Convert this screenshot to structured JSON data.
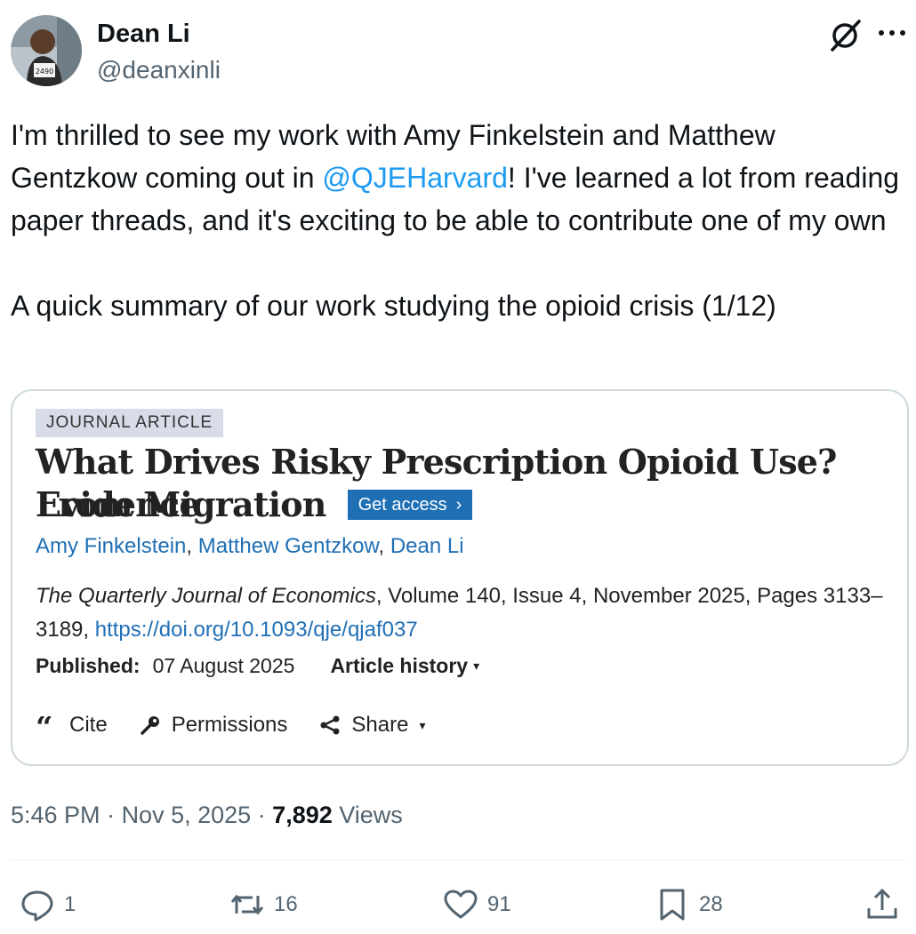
{
  "author": {
    "name": "Dean Li",
    "handle": "@deanxinli",
    "avatar_number": "2490"
  },
  "tweet": {
    "text_before_mention": "I'm thrilled to see my work with Amy Finkelstein and Matthew Gentzkow coming out in ",
    "mention": "@QJEHarvard",
    "text_after_mention": "! I've learned a lot from reading paper threads, and it's exciting to be able to contribute one of my own\n\nA quick summary of our work studying the opioid crisis (1/12)"
  },
  "card": {
    "badge": "JOURNAL ARTICLE",
    "title_line1": "What Drives Risky Prescription Opioid Use? Evidence",
    "title_line2": "From Migration",
    "access_label": "Get access",
    "access_chevron": "›",
    "authors": [
      "Amy Finkelstein",
      "Matthew Gentzkow",
      "Dean Li"
    ],
    "author_sep": ", ",
    "journal": "The Quarterly Journal of Economics",
    "citation_rest": ", Volume 140, Issue 4, November 2025, Pages 3133–3189, ",
    "doi": "https://doi.org/10.1093/qje/qjaf037",
    "published_label": "Published:",
    "published_date": "07 August 2025",
    "history_label": "Article history",
    "cite_label": "Cite",
    "permissions_label": "Permissions",
    "share_label": "Share",
    "caret": "▾"
  },
  "meta": {
    "time": "5:46 PM",
    "dot": " · ",
    "date": "Nov 5, 2025",
    "views_count": "7,892",
    "views_label": " Views"
  },
  "stats": {
    "replies": "1",
    "reposts": "16",
    "likes": "91",
    "bookmarks": "28"
  },
  "colors": {
    "accent": "#1d9bf0",
    "secondary_text": "#536471",
    "journal_link": "#1f6fb5"
  },
  "icons": [
    "grok-icon",
    "more-icon",
    "cite-icon",
    "key-icon",
    "share-icon",
    "reply-icon",
    "repost-icon",
    "like-icon",
    "bookmark-icon",
    "upload-icon"
  ]
}
